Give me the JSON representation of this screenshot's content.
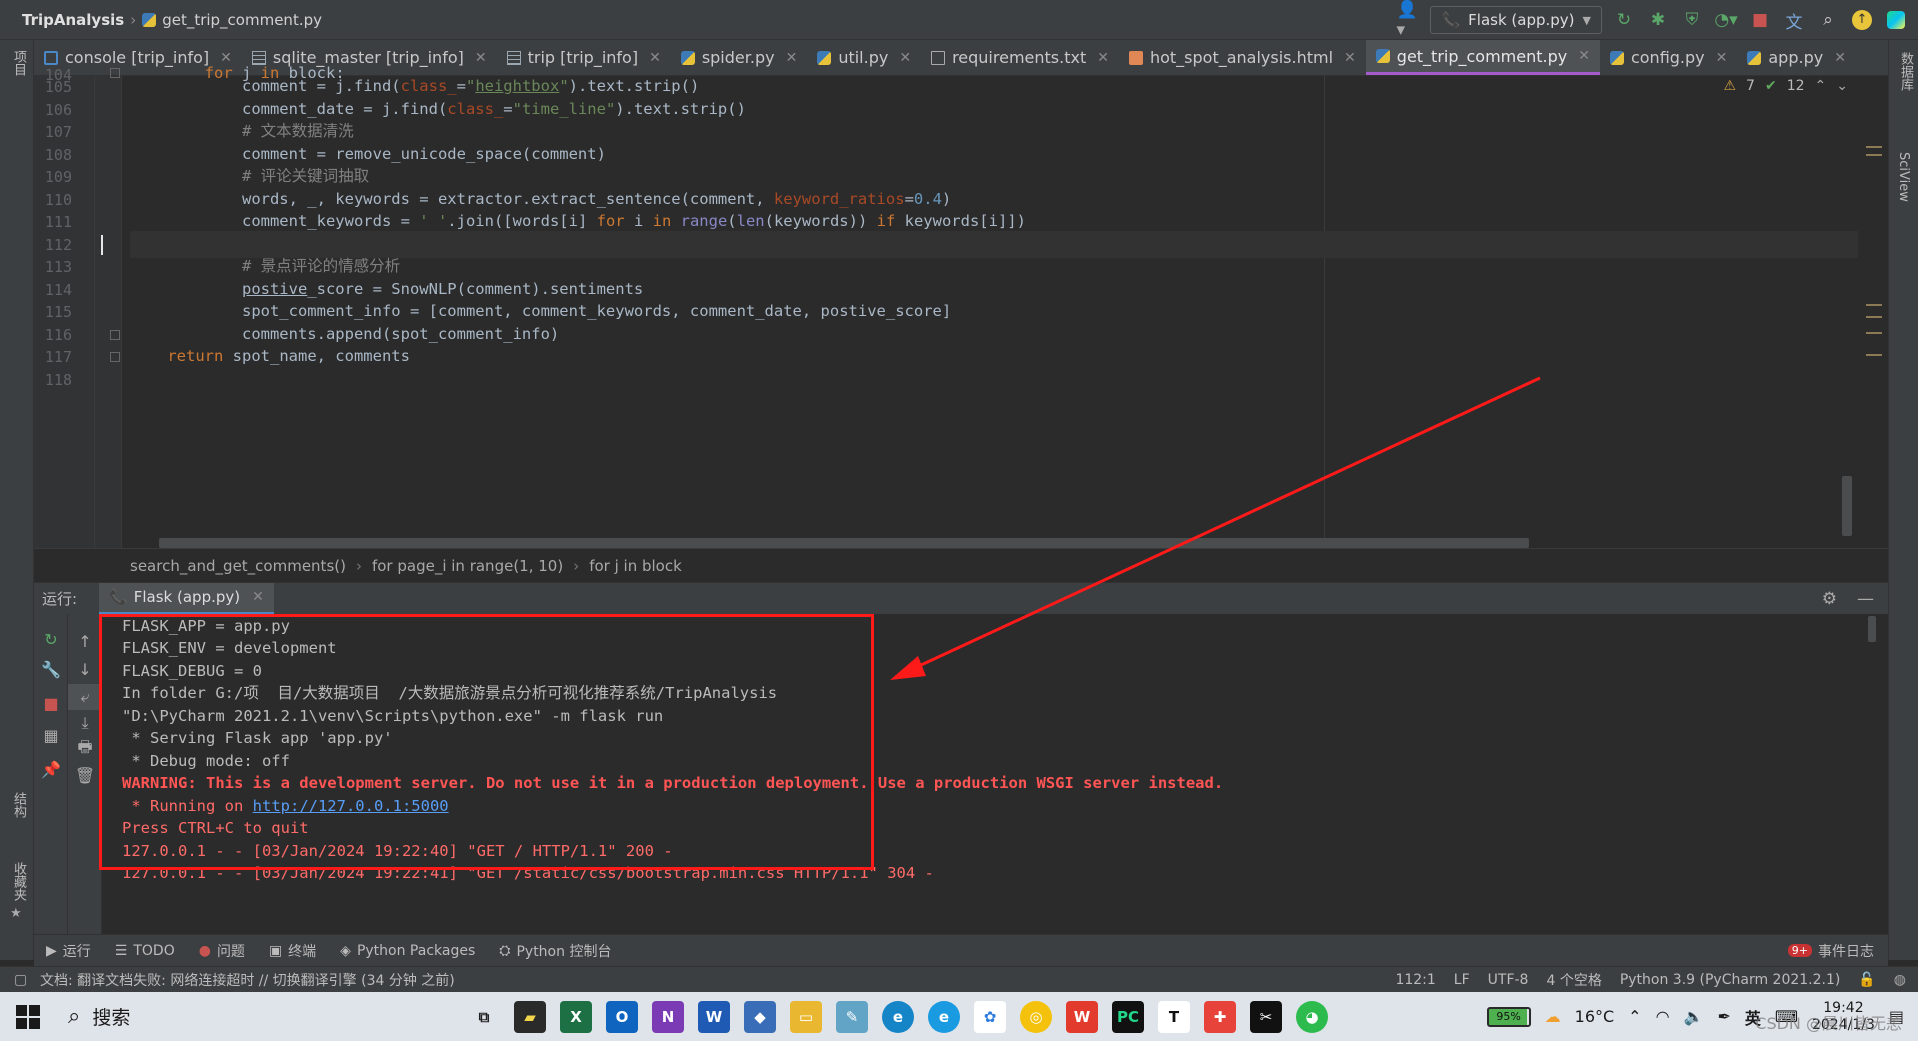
{
  "titlebar": {
    "project": "TripAnalysis",
    "file": "get_trip_comment.py",
    "run_config": "Flask (app.py)"
  },
  "tabs": [
    {
      "label": "console [trip_info]",
      "icon": "console-icon",
      "active": false
    },
    {
      "label": "sqlite_master [trip_info]",
      "icon": "table-icon",
      "active": false
    },
    {
      "label": "trip [trip_info]",
      "icon": "table-icon",
      "active": false
    },
    {
      "label": "spider.py",
      "icon": "python-file-icon",
      "active": false
    },
    {
      "label": "util.py",
      "icon": "python-file-icon",
      "active": false
    },
    {
      "label": "requirements.txt",
      "icon": "text-file-icon",
      "active": false
    },
    {
      "label": "hot_spot_analysis.html",
      "icon": "html-file-icon",
      "active": false
    },
    {
      "label": "get_trip_comment.py",
      "icon": "python-file-icon",
      "active": true
    },
    {
      "label": "config.py",
      "icon": "python-file-icon",
      "active": false
    },
    {
      "label": "app.py",
      "icon": "python-file-icon",
      "active": false
    }
  ],
  "inspections": {
    "warnings": "7",
    "ok": "12"
  },
  "code": {
    "line_numbers": [
      "104",
      "105",
      "106",
      "107",
      "108",
      "109",
      "110",
      "111",
      "112",
      "113",
      "114",
      "115",
      "116",
      "117",
      "118"
    ],
    "current_line": "112"
  },
  "breadcrumb": [
    "search_and_get_comments()",
    "for page_i in range(1, 10)",
    "for j in block"
  ],
  "run": {
    "label": "运行:",
    "tab": "Flask (app.py)",
    "output": [
      "FLASK_APP = app.py",
      "FLASK_ENV = development",
      "FLASK_DEBUG = 0",
      "In folder G:/项  目/大数据项目  /大数据旅游景点分析可视化推荐系统/TripAnalysis",
      "\"D:\\PyCharm 2021.2.1\\venv\\Scripts\\python.exe\" -m flask run",
      " * Serving Flask app 'app.py'",
      " * Debug mode: off",
      "WARNING: This is a development server. Do not use it in a production deployment. Use a production WSGI server instead.",
      " * Running on ",
      "Press CTRL+C to quit",
      "127.0.0.1 - - [03/Jan/2024 19:22:40] \"GET / HTTP/1.1\" 200 -",
      "127.0.0.1 - - [03/Jan/2024 19:22:41] \"GET /static/css/bootstrap.min.css HTTP/1.1\" 304 -"
    ],
    "link": "http://127.0.0.1:5000"
  },
  "bottom_tabs": [
    {
      "label": "运行",
      "icon": "play-icon"
    },
    {
      "label": "TODO",
      "icon": "list-icon"
    },
    {
      "label": "问题",
      "icon": "error-icon"
    },
    {
      "label": "终端",
      "icon": "terminal-icon"
    },
    {
      "label": "Python Packages",
      "icon": "layers-icon"
    },
    {
      "label": "Python 控制台",
      "icon": "python-icon"
    }
  ],
  "event_log": {
    "label": "事件日志",
    "badge": "9+"
  },
  "statusbar": {
    "message": "文档: 翻译文档失败: 网络连接超时 // 切换翻译引擎 (34 分钟 之前)",
    "position": "112:1",
    "line_sep": "LF",
    "encoding": "UTF-8",
    "indent": "4 个空格",
    "interpreter": "Python 3.9 (PyCharm 2021.2.1)"
  },
  "left_strip": {
    "project": "项目",
    "structure": "结构",
    "favorites": "收藏夹"
  },
  "right_strip": {
    "database": "数据库",
    "sciview": "SciView"
  },
  "taskbar": {
    "search": "搜索",
    "weather": "16°C",
    "ime": "英",
    "time": "19:42",
    "date": "2024/1/3",
    "battery": "95%",
    "watermark": "CSDN @晨川皆无恙"
  },
  "colors": {
    "accent": "#a35cc9",
    "highlight_box": "#ff1a1a",
    "warning_text": "#ff5555",
    "link": "#589df6"
  }
}
